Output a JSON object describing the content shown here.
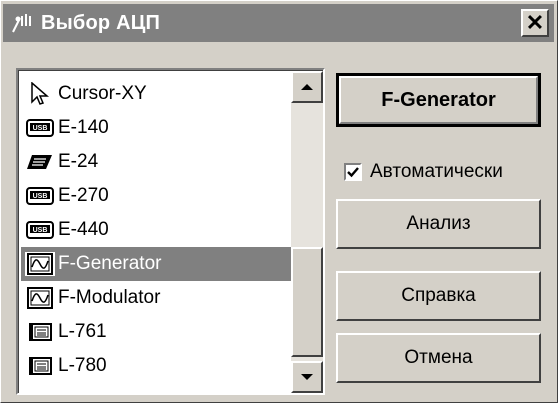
{
  "window": {
    "title": "Выбор АЦП",
    "icon": "signal-icon",
    "close_label": "✕"
  },
  "device_list": {
    "items": [
      {
        "label": "Cursor-XY",
        "icon": "cursor-icon",
        "selected": false
      },
      {
        "label": "E-140",
        "icon": "usb-device-icon",
        "selected": false
      },
      {
        "label": "E-24",
        "icon": "pcmcia-card-icon",
        "selected": false
      },
      {
        "label": "E-270",
        "icon": "usb-device-icon",
        "selected": false
      },
      {
        "label": "E-440",
        "icon": "usb-device-icon",
        "selected": false
      },
      {
        "label": "F-Generator",
        "icon": "waveform-icon",
        "selected": true
      },
      {
        "label": "F-Modulator",
        "icon": "waveform-icon",
        "selected": false
      },
      {
        "label": "L-761",
        "icon": "pci-board-icon",
        "selected": false
      },
      {
        "label": "L-780",
        "icon": "pci-board-icon",
        "selected": false
      }
    ]
  },
  "buttons": {
    "selected_device": "F-Generator",
    "analyze": "Анализ",
    "help": "Справка",
    "cancel": "Отмена"
  },
  "auto_checkbox": {
    "label": "Автоматически",
    "checked": true
  },
  "colors": {
    "face": "#d4d0c8",
    "titlebar_inactive": "#808080",
    "selection": "#808080"
  }
}
